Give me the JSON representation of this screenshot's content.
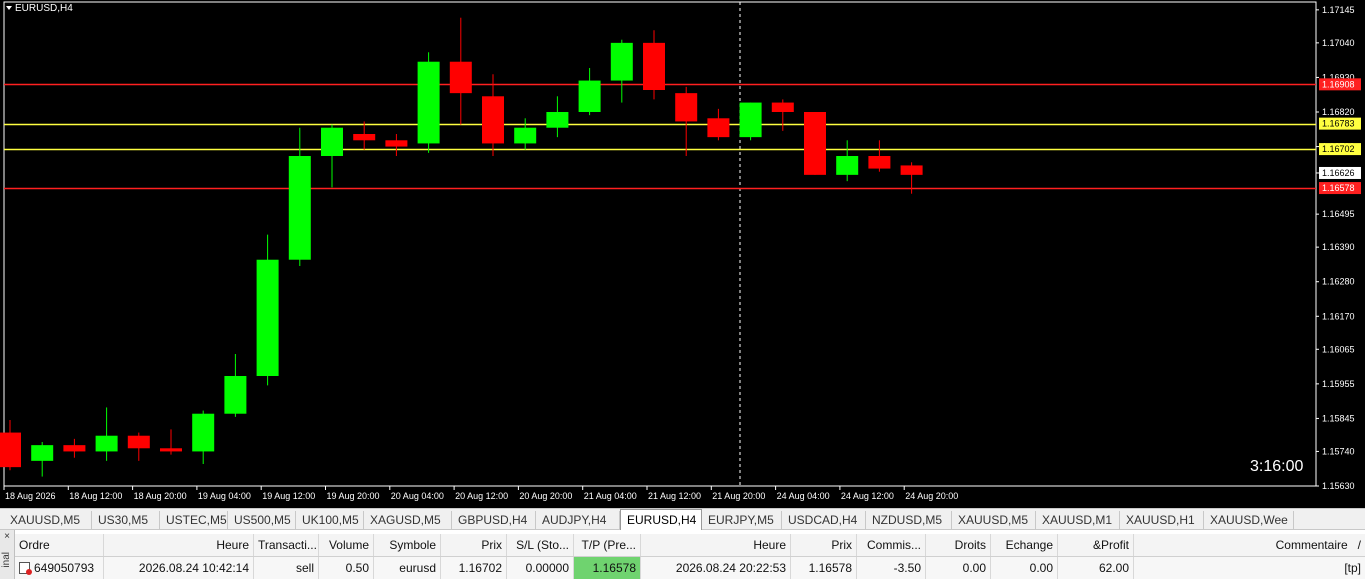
{
  "chart": {
    "symbol_label": "EURUSD,H4",
    "countdown": "3:16:00",
    "price_axis": [
      "1.17145",
      "1.17040",
      "1.16930",
      "1.16820",
      "1.16710",
      "1.16626",
      "1.16495",
      "1.16390",
      "1.16280",
      "1.16170",
      "1.16065",
      "1.15955",
      "1.15845",
      "1.15740",
      "1.15630"
    ],
    "time_axis": [
      "18 Aug 2026",
      "18 Aug 12:00",
      "18 Aug 20:00",
      "19 Aug 04:00",
      "19 Aug 12:00",
      "19 Aug 20:00",
      "20 Aug 04:00",
      "20 Aug 12:00",
      "20 Aug 20:00",
      "21 Aug 04:00",
      "21 Aug 12:00",
      "21 Aug 20:00",
      "24 Aug 04:00",
      "24 Aug 12:00",
      "24 Aug 20:00"
    ],
    "level_lines": [
      {
        "price": 1.16908,
        "label": "1.16908",
        "color": "#ff2020"
      },
      {
        "price": 1.16783,
        "label": "1.16783",
        "color": "#ffff40"
      },
      {
        "price": 1.16702,
        "label": "1.16702",
        "color": "#ffff40"
      },
      {
        "price": 1.16578,
        "label": "1.16578",
        "color": "#ff2020"
      }
    ],
    "current_price": {
      "price": 1.16626,
      "label": "1.16626"
    },
    "colors": {
      "bull": "#00ff00",
      "bear": "#ff0000",
      "background": "#000000",
      "grid": "#ffffff"
    }
  },
  "chart_data": {
    "type": "candlestick",
    "title": "EURUSD,H4",
    "ylim": [
      1.1563,
      1.1717
    ],
    "candles": [
      {
        "o": 1.158,
        "h": 1.1584,
        "l": 1.1568,
        "c": 1.1569
      },
      {
        "o": 1.1571,
        "h": 1.1577,
        "l": 1.1566,
        "c": 1.1576
      },
      {
        "o": 1.1576,
        "h": 1.1578,
        "l": 1.1572,
        "c": 1.1574
      },
      {
        "o": 1.1574,
        "h": 1.1588,
        "l": 1.1571,
        "c": 1.1579
      },
      {
        "o": 1.1579,
        "h": 1.158,
        "l": 1.1571,
        "c": 1.1575
      },
      {
        "o": 1.1575,
        "h": 1.1581,
        "l": 1.1573,
        "c": 1.1574
      },
      {
        "o": 1.1574,
        "h": 1.1587,
        "l": 1.157,
        "c": 1.1586
      },
      {
        "o": 1.1586,
        "h": 1.1605,
        "l": 1.1585,
        "c": 1.1598
      },
      {
        "o": 1.1598,
        "h": 1.1643,
        "l": 1.1595,
        "c": 1.1635
      },
      {
        "o": 1.1635,
        "h": 1.1677,
        "l": 1.1633,
        "c": 1.1668
      },
      {
        "o": 1.1668,
        "h": 1.1678,
        "l": 1.1658,
        "c": 1.1677
      },
      {
        "o": 1.1675,
        "h": 1.1679,
        "l": 1.167,
        "c": 1.1673
      },
      {
        "o": 1.1673,
        "h": 1.1675,
        "l": 1.1668,
        "c": 1.1671
      },
      {
        "o": 1.1672,
        "h": 1.1701,
        "l": 1.1669,
        "c": 1.1698
      },
      {
        "o": 1.1698,
        "h": 1.1712,
        "l": 1.1678,
        "c": 1.1688
      },
      {
        "o": 1.1687,
        "h": 1.1694,
        "l": 1.1668,
        "c": 1.1672
      },
      {
        "o": 1.1672,
        "h": 1.168,
        "l": 1.167,
        "c": 1.1677
      },
      {
        "o": 1.1677,
        "h": 1.1687,
        "l": 1.1674,
        "c": 1.1682
      },
      {
        "o": 1.1682,
        "h": 1.1696,
        "l": 1.1681,
        "c": 1.1692
      },
      {
        "o": 1.1692,
        "h": 1.1705,
        "l": 1.1685,
        "c": 1.1704
      },
      {
        "o": 1.1704,
        "h": 1.1708,
        "l": 1.1686,
        "c": 1.1689
      },
      {
        "o": 1.1688,
        "h": 1.169,
        "l": 1.1668,
        "c": 1.1679
      },
      {
        "o": 1.168,
        "h": 1.1683,
        "l": 1.1673,
        "c": 1.1674
      },
      {
        "o": 1.1674,
        "h": 1.1685,
        "l": 1.1673,
        "c": 1.1685
      },
      {
        "o": 1.1685,
        "h": 1.1686,
        "l": 1.1676,
        "c": 1.1682
      },
      {
        "o": 1.1682,
        "h": 1.1682,
        "l": 1.1662,
        "c": 1.1662
      },
      {
        "o": 1.1662,
        "h": 1.1673,
        "l": 1.166,
        "c": 1.1668
      },
      {
        "o": 1.1668,
        "h": 1.1673,
        "l": 1.1663,
        "c": 1.1664
      },
      {
        "o": 1.1665,
        "h": 1.1666,
        "l": 1.1656,
        "c": 1.1662
      }
    ]
  },
  "tabs": [
    "XAUUSD,M5",
    "US30,M5",
    "USTEC,M5",
    "US500,M5",
    "UK100,M5",
    "XAGUSD,M5",
    "GBPUSD,H4",
    "AUDJPY,H4",
    "EURUSD,H4",
    "EURJPY,M5",
    "USDCAD,H4",
    "NZDUSD,M5",
    "XAUUSD,M5",
    "XAUUSD,M1",
    "XAUUSD,H1",
    "XAUUSD,Wee"
  ],
  "active_tab": "EURUSD,H4",
  "terminal": {
    "side_label": "inal",
    "close_glyph": "×",
    "columns": {
      "order": "Ordre",
      "time": "Heure",
      "type": "Transacti...",
      "volume": "Volume",
      "symbol": "Symbole",
      "price": "Prix",
      "sl": "S/L (Sto...",
      "tp": "T/P (Pre...",
      "close_time": "Heure",
      "close_price": "Prix",
      "commission": "Commis...",
      "fees": "Droits",
      "swap": "Echange",
      "profit": "&Profit",
      "comment": "Commentaire"
    },
    "sort_indicator": "/",
    "row": {
      "order": "649050793",
      "time": "2026.08.24 10:42:14",
      "type": "sell",
      "volume": "0.50",
      "symbol": "eurusd",
      "price": "1.16702",
      "sl": "0.00000",
      "tp": "1.16578",
      "close_time": "2026.08.24 20:22:53",
      "close_price": "1.16578",
      "commission": "-3.50",
      "fees": "0.00",
      "swap": "0.00",
      "profit": "62.00",
      "comment": "[tp]"
    }
  }
}
